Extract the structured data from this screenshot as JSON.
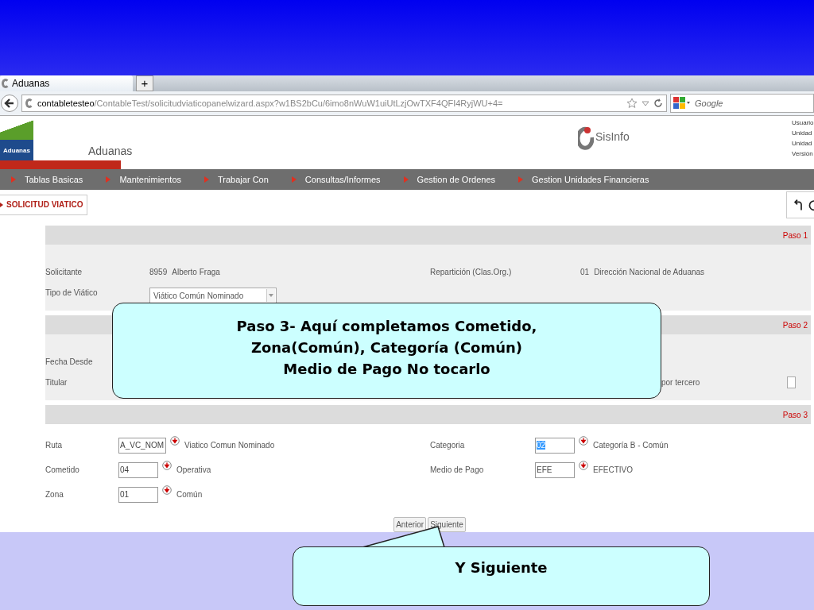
{
  "browser": {
    "tab": {
      "title": "Aduanas"
    },
    "new_tab": "+",
    "url_host": "contabletesteo",
    "url_path": "/ContableTest/solicitudviaticopanelwizard.aspx?w1BS2bCu/6imo8nWuW1uiUtLzjOwTXF4QFI4RyjWU+4=",
    "search_placeholder": "Google"
  },
  "header": {
    "logo_text": "Aduanas",
    "app_title": "Aduanas",
    "brand": "SisInfo",
    "user_info": [
      "Usuario",
      "Unidad",
      "Unidad",
      "Versión"
    ]
  },
  "menu": [
    "Tablas Basicas",
    "Mantenimientos",
    "Trabajar Con",
    "Consultas/Informes",
    "Gestion de Ordenes",
    "Gestion Unidades Financieras"
  ],
  "toolbar": {
    "title": "SOLICITUD VIATICO"
  },
  "sections": [
    {
      "step": "Paso 1",
      "active": false,
      "rows": [
        {
          "left": {
            "kind": "text",
            "label": "Solicitante",
            "code": "8959",
            "value": "Alberto Fraga"
          },
          "right": {
            "kind": "text",
            "label": "Repartición (Clas.Org.)",
            "code": "01",
            "value": "Dirección Nacional de Aduanas"
          }
        },
        {
          "left": {
            "kind": "select",
            "label": "Tipo de Viático",
            "value": "Viático Común Nominado"
          }
        }
      ]
    },
    {
      "step": "Paso 2",
      "active": false,
      "rows": [
        {
          "left": {
            "kind": "label",
            "label": "Fecha Desde"
          }
        },
        {
          "left": {
            "kind": "label",
            "label": "Titular"
          },
          "right": {
            "kind": "checkbox",
            "label": "por tercero",
            "checked": false
          }
        }
      ]
    },
    {
      "step": "Paso 3",
      "active": true,
      "rows": [
        {
          "left": {
            "kind": "input",
            "label": "Ruta",
            "code": "A_VC_NOM",
            "value": "Viatico Comun Nominado",
            "selected": false
          },
          "right": {
            "kind": "input",
            "label": "Categoria",
            "code": "02",
            "value": "Categoría B - Común",
            "selected": true
          }
        },
        {
          "left": {
            "kind": "input",
            "label": "Cometido",
            "code": "04",
            "value": "Operativa",
            "selected": false
          },
          "right": {
            "kind": "input",
            "label": "Medio de Pago",
            "code": "EFE",
            "value": "EFECTIVO",
            "selected": false
          }
        },
        {
          "left": {
            "kind": "input",
            "label": "Zona",
            "code": "01",
            "value": "Común",
            "selected": false
          }
        }
      ]
    }
  ],
  "buttons": [
    "Anterior",
    "Siguiente"
  ],
  "callouts": [
    {
      "lines": [
        "Paso 3- Aquí completamos Cometido,",
        "Zona(Común), Categoría (Común)",
        "Medio de Pago No tocarlo"
      ]
    },
    {
      "lines": [
        "Y Siguiente"
      ]
    }
  ]
}
